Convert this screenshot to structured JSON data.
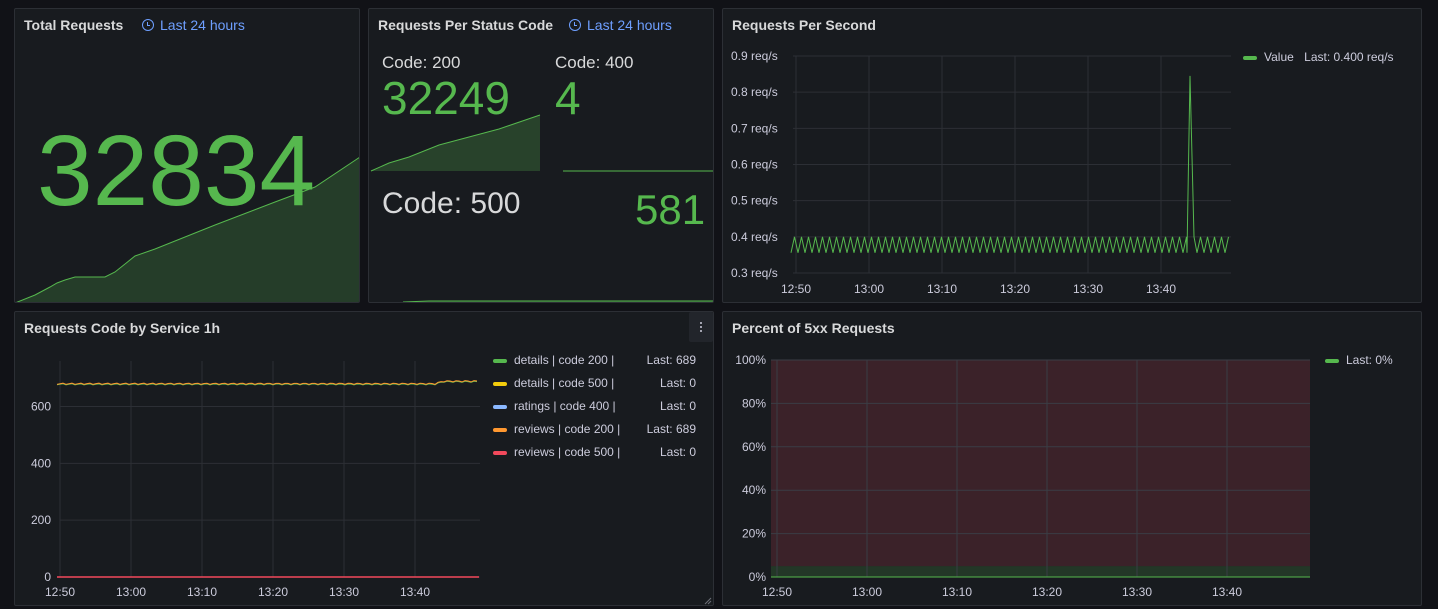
{
  "colors": {
    "green": "#56b84e",
    "yellow": "#f2cc0c",
    "blue": "#8ab8ff",
    "orange": "#ff9830",
    "red": "#f2495c",
    "link": "#6e9fff"
  },
  "total_requests": {
    "title": "Total Requests",
    "time_range": "Last 24 hours",
    "value": "32834"
  },
  "status_code": {
    "title": "Requests Per Status Code",
    "time_range": "Last 24 hours",
    "code200": {
      "label": "Code: 200",
      "value": "32249"
    },
    "code400": {
      "label": "Code: 400",
      "value": "4"
    },
    "code500": {
      "label": "Code: 500",
      "value": "581"
    }
  },
  "rps": {
    "title": "Requests Per Second",
    "legend_name": "Value",
    "legend_last": "Last: 0.400 req/s"
  },
  "by_service": {
    "title": "Requests Code by Service 1h",
    "legend": [
      {
        "name": "details | code 200 |",
        "last": "Last: 689",
        "color": "#56b84e"
      },
      {
        "name": "details | code 500 |",
        "last": "Last: 0",
        "color": "#f2cc0c"
      },
      {
        "name": "ratings | code 400 |",
        "last": "Last: 0",
        "color": "#8ab8ff"
      },
      {
        "name": "reviews | code 200 |",
        "last": "Last: 689",
        "color": "#ff9830"
      },
      {
        "name": "reviews | code 500 |",
        "last": "Last: 0",
        "color": "#f2495c"
      }
    ]
  },
  "pct5xx": {
    "title": "Percent of 5xx Requests",
    "legend_last": "Last: 0%"
  },
  "chart_data": [
    {
      "type": "line",
      "title": "Requests Per Second",
      "x": [
        "12:50",
        "13:00",
        "13:10",
        "13:20",
        "13:30",
        "13:40"
      ],
      "yticks": [
        "0.3 req/s",
        "0.4 req/s",
        "0.5 req/s",
        "0.6 req/s",
        "0.7 req/s",
        "0.8 req/s",
        "0.9 req/s"
      ],
      "ylim": [
        0.3,
        0.9
      ],
      "series": [
        {
          "name": "Value",
          "pattern": "oscillates 0.356-0.400",
          "spike_at": "13:44",
          "spike_value": 0.845,
          "last": 0.4
        }
      ],
      "grid": true,
      "legend": "top-right"
    },
    {
      "type": "line",
      "title": "Requests Code by Service 1h",
      "x": [
        "12:50",
        "13:00",
        "13:10",
        "13:20",
        "13:30",
        "13:40"
      ],
      "yticks": [
        "0",
        "200",
        "400",
        "600"
      ],
      "ylim": [
        0,
        760
      ],
      "series": [
        {
          "name": "details | code 200 |",
          "approx": 680,
          "last": 689
        },
        {
          "name": "details | code 500 |",
          "approx": 0,
          "last": 0
        },
        {
          "name": "ratings | code 400 |",
          "approx": 0,
          "last": 0
        },
        {
          "name": "reviews | code 200 |",
          "approx": 680,
          "last": 689
        },
        {
          "name": "reviews | code 500 |",
          "approx": 0,
          "last": 0
        }
      ],
      "grid": true,
      "legend": "right"
    },
    {
      "type": "area",
      "title": "Percent of 5xx Requests",
      "x": [
        "12:50",
        "13:00",
        "13:10",
        "13:20",
        "13:30",
        "13:40"
      ],
      "yticks": [
        "0%",
        "20%",
        "40%",
        "60%",
        "80%",
        "100%"
      ],
      "ylim": [
        0,
        100
      ],
      "series": [
        {
          "values": [
            0,
            0,
            0,
            0,
            0,
            0
          ],
          "last": 0
        }
      ],
      "thresholds": [
        {
          "from": 0,
          "to": 5,
          "color": "green"
        },
        {
          "from": 5,
          "to": 100,
          "color": "red"
        }
      ],
      "grid": true,
      "legend": "top-right"
    }
  ]
}
